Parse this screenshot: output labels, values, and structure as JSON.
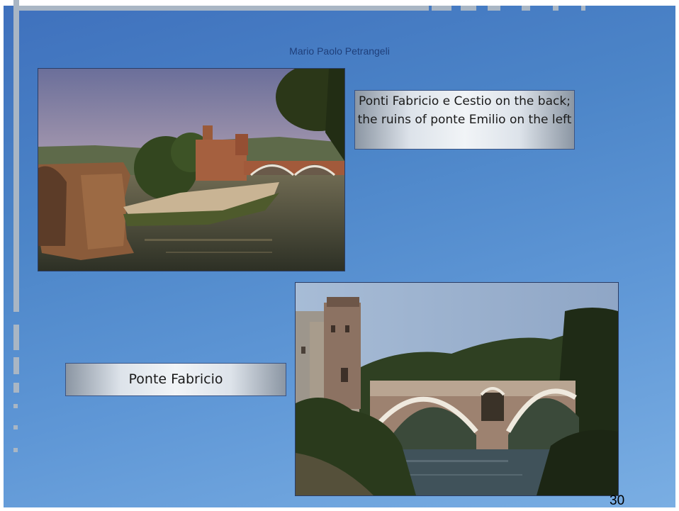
{
  "slide": {
    "author": "Mario Paolo Petrangeli",
    "page_number": "30",
    "photos": [
      {
        "caption": "Ponti Fabricio e Cestio on the back; the ruins of ponte Emilio on the left"
      },
      {
        "caption": "Ponte Fabricio"
      }
    ]
  }
}
